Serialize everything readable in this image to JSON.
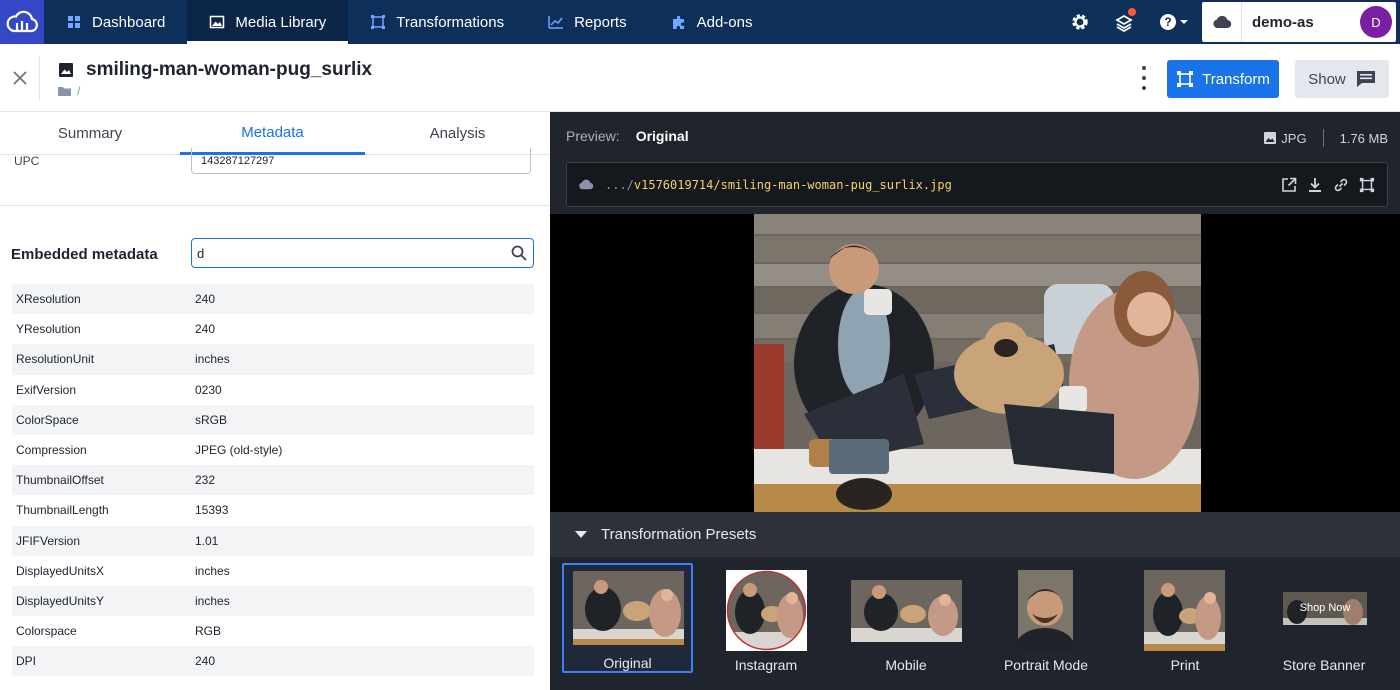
{
  "nav": {
    "items": [
      {
        "label": "Dashboard",
        "icon": "dashboard-icon"
      },
      {
        "label": "Media Library",
        "icon": "image-icon",
        "active": true
      },
      {
        "label": "Transformations",
        "icon": "transform-icon"
      },
      {
        "label": "Reports",
        "icon": "chart-icon"
      },
      {
        "label": "Add-ons",
        "icon": "puzzle-icon"
      }
    ],
    "account": {
      "name": "demo-as",
      "avatar_initial": "D"
    }
  },
  "asset": {
    "title": "smiling-man-woman-pug_surlix",
    "breadcrumb": "/",
    "transform_label": "Transform",
    "show_label": "Show"
  },
  "tabs": [
    {
      "label": "Summary"
    },
    {
      "label": "Metadata",
      "active": true
    },
    {
      "label": "Analysis"
    }
  ],
  "metadata": {
    "upc_label": "UPC",
    "upc_value": "143287127297",
    "embedded_label": "Embedded metadata",
    "search_value": "d",
    "rows": [
      {
        "key": "XResolution",
        "value": "240"
      },
      {
        "key": "YResolution",
        "value": "240"
      },
      {
        "key": "ResolutionUnit",
        "value": "inches"
      },
      {
        "key": "ExifVersion",
        "value": "0230"
      },
      {
        "key": "ColorSpace",
        "value": "sRGB"
      },
      {
        "key": "Compression",
        "value": "JPEG (old-style)"
      },
      {
        "key": "ThumbnailOffset",
        "value": "232"
      },
      {
        "key": "ThumbnailLength",
        "value": "15393"
      },
      {
        "key": "JFIFVersion",
        "value": "1.01"
      },
      {
        "key": "DisplayedUnitsX",
        "value": "inches"
      },
      {
        "key": "DisplayedUnitsY",
        "value": "inches"
      },
      {
        "key": "Colorspace",
        "value": "RGB"
      },
      {
        "key": "DPI",
        "value": "240"
      }
    ]
  },
  "preview": {
    "label": "Preview:",
    "mode": "Original",
    "format": "JPG",
    "size": "1.76 MB",
    "url_prefix": ".../",
    "url_path": "v1576019714/smiling-man-woman-pug_surlix.jpg"
  },
  "presets": {
    "title": "Transformation Presets",
    "items": [
      {
        "label": "Original",
        "selected": true
      },
      {
        "label": "Instagram"
      },
      {
        "label": "Mobile"
      },
      {
        "label": "Portrait Mode"
      },
      {
        "label": "Print"
      },
      {
        "label": "Store Banner",
        "overlay_text": "Shop Now"
      }
    ]
  },
  "colors": {
    "nav_bg": "#0e2f5a",
    "logo_bg": "#3448c5",
    "accent": "#1a73e8",
    "preview_bg": "#20242c",
    "avatar": "#7b1fa2",
    "url_text": "#f5d26b"
  }
}
